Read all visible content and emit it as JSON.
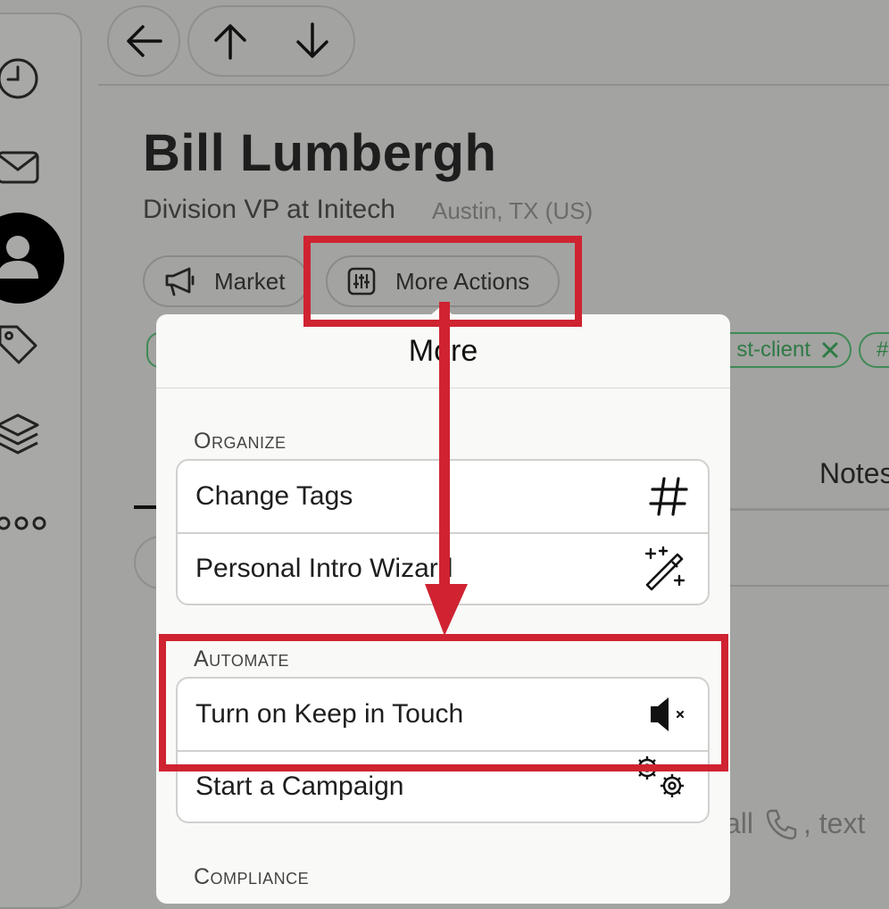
{
  "nav": {
    "back_icon": "arrow-left-icon",
    "up_icon": "arrow-up-icon",
    "down_icon": "arrow-down-icon"
  },
  "sidebar": {
    "icons": [
      "clock-icon",
      "mail-icon",
      "person-icon",
      "tag-icon",
      "layers-icon",
      "more-dots-icon"
    ],
    "active": "person-icon"
  },
  "contact": {
    "name": "Bill Lumbergh",
    "title": "Division VP at Initech",
    "location": "Austin, TX (US)"
  },
  "actions": {
    "market_label": "Market",
    "more_label": "More Actions"
  },
  "tags": [
    {
      "label": "st-client"
    },
    {
      "label": "#"
    }
  ],
  "background": {
    "notes_tab": "Notes",
    "hint": "all",
    "hint_text": ", text"
  },
  "popup": {
    "title": "More",
    "sections": [
      {
        "label": "Organize",
        "items": [
          {
            "label": "Change Tags",
            "icon": "hash-icon"
          },
          {
            "label": "Personal Intro Wizard",
            "icon": "magic-wand-icon"
          }
        ]
      },
      {
        "label": "Automate",
        "items": [
          {
            "label": "Turn on Keep in Touch",
            "icon": "speaker-muted-icon"
          },
          {
            "label": "Start a Campaign",
            "icon": "gears-icon"
          }
        ]
      },
      {
        "label": "Compliance",
        "items": []
      }
    ]
  },
  "colors": {
    "annotation": "#cf2331",
    "tag_green": "#3f8a55",
    "overlay": "#a3a3a1"
  }
}
